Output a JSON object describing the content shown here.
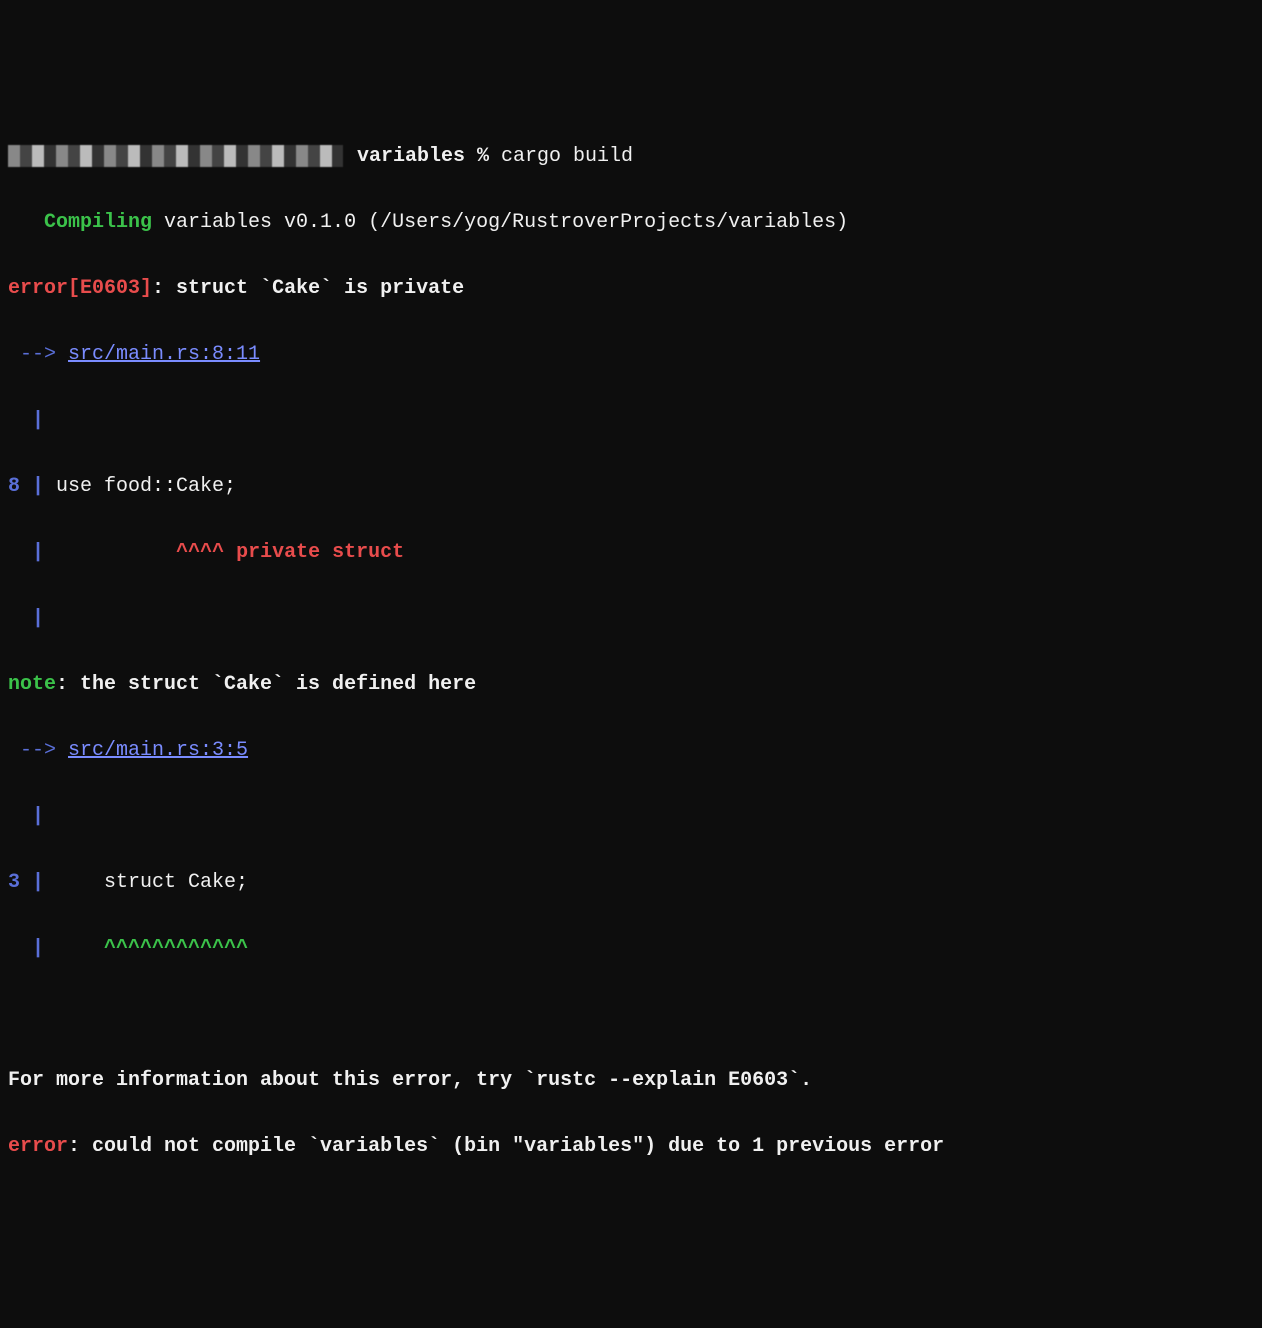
{
  "prompt": {
    "path_suffix": " variables % ",
    "command": "cargo build"
  },
  "compiling": {
    "prefix": "   Compiling",
    "text": " variables v0.1.0 (/Users/yog/RustroverProjects/variables)"
  },
  "error_header": {
    "prefix": "error[E0603]",
    "colon": ": ",
    "message": "struct `Cake` is private"
  },
  "arrow1": {
    "arrow": " --> ",
    "location": "src/main.rs:8:11"
  },
  "gutter_pipe": "  |",
  "code_line": {
    "lineno": "8 ",
    "pipe": "| ",
    "code": "use food::Cake;"
  },
  "caret_line": {
    "gutter": "  ",
    "pipe": "| ",
    "spaces": "          ",
    "carets": "^^^^",
    "label": " private struct"
  },
  "note": {
    "prefix": "note",
    "text": ": the struct `Cake` is defined here"
  },
  "arrow2": {
    "arrow": " --> ",
    "location": "src/main.rs:3:5"
  },
  "code_line2": {
    "lineno": "3 ",
    "pipe": "| ",
    "code": "    struct Cake;"
  },
  "caret_line2": {
    "gutter": "  ",
    "pipe": "| ",
    "spaces": "    ",
    "carets": "^^^^^^^^^^^^"
  },
  "more_info": "For more information about this error, try `rustc --explain E0603`.",
  "final_error": {
    "prefix": "error",
    "text": ": could not compile `variables` (bin \"variables\") due to 1 previous error"
  }
}
